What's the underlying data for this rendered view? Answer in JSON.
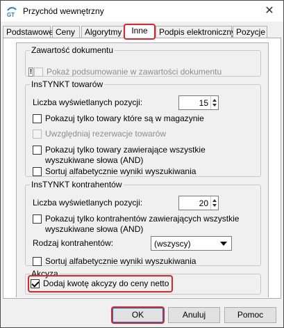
{
  "window": {
    "title": "Przychód wewnętrzny",
    "close_glyph": "✕"
  },
  "tabs": [
    {
      "label": "Podstawowe",
      "active": false
    },
    {
      "label": "Ceny",
      "active": false
    },
    {
      "label": "Algorytmy",
      "active": false
    },
    {
      "label": "Inne",
      "active": true
    },
    {
      "label": "Podpis elektroniczny",
      "active": false
    },
    {
      "label": "Pozycje",
      "active": false
    }
  ],
  "document_contents": {
    "title": "Zawartość dokumentu",
    "show_summary_label": "Pokaż podsumowanie w zawartości dokumentu",
    "show_summary_checked": false,
    "show_summary_enabled": false,
    "warning_glyph": "!"
  },
  "insytnkt_goods": {
    "title": "InsTYNKT towarów",
    "count_label": "Liczba wyświetlanych pozycji:",
    "count_value": "15",
    "only_in_stock_label": "Pokazuj tylko towary które są w magazynie",
    "only_in_stock_checked": false,
    "reservations_label": "Uwzględniaj rezerwacje towarów",
    "reservations_checked": false,
    "reservations_enabled": false,
    "all_words_label": "Pokazuj tylko towary zawierające wszystkie wyszukiwane słowa (AND)",
    "all_words_checked": false,
    "sort_label": "Sortuj alfabetycznie wyniki wyszukiwania",
    "sort_checked": false
  },
  "insytnkt_contractors": {
    "title": "InsTYNKT kontrahentów",
    "count_label": "Liczba wyświetlanych pozycji:",
    "count_value": "20",
    "all_words_label": "Pokazuj tylko kontrahentów zawierających wszystkie wyszukiwane słowa (AND)",
    "all_words_checked": false,
    "type_label": "Rodzaj kontrahentów:",
    "type_value": "(wszyscy)",
    "sort_label": "Sortuj alfabetycznie wyniki wyszukiwania",
    "sort_checked": false
  },
  "excise": {
    "title": "Akcyza",
    "add_excise_label": "Dodaj kwotę akcyzy do ceny netto",
    "add_excise_checked": true
  },
  "buttons": {
    "ok": "OK",
    "cancel": "Anuluj",
    "help": "Pomoc"
  },
  "colors": {
    "highlight": "#e0242a",
    "default_button_border": "#0078d7"
  }
}
